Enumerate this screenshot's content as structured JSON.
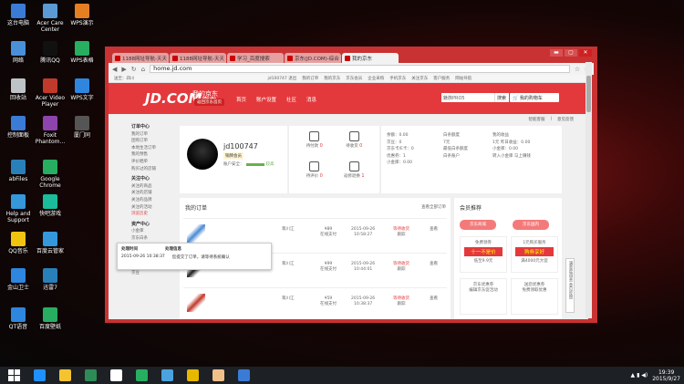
{
  "desktop_icons": [
    {
      "label": "这台电脑",
      "color": "#3a7bd5"
    },
    {
      "label": "Acer Care Center",
      "color": "#5b9bd5"
    },
    {
      "label": "WPS演示",
      "color": "#e67e22"
    },
    {
      "label": "网络",
      "color": "#4a90d9"
    },
    {
      "label": "腾讯QQ",
      "color": "#111111"
    },
    {
      "label": "WPS表格",
      "color": "#27ae60"
    },
    {
      "label": "回收站",
      "color": "#bdc3c7"
    },
    {
      "label": "Acer Video Player",
      "color": "#c0392b"
    },
    {
      "label": "WPS文字",
      "color": "#2e86de"
    },
    {
      "label": "控制面板",
      "color": "#3a7bd5"
    },
    {
      "label": "Foxit Phantom...",
      "color": "#8e44ad"
    },
    {
      "label": "厦门同",
      "color": "#555555"
    },
    {
      "label": "abFiles",
      "color": "#2980b9"
    },
    {
      "label": "Google Chrome",
      "color": "#27ae60"
    },
    {
      "label": "Help and Support",
      "color": "#3498db"
    },
    {
      "label": "快吧游戏",
      "color": "#1abc9c"
    },
    {
      "label": "QQ音乐",
      "color": "#f1c40f"
    },
    {
      "label": "百度云管家",
      "color": "#3498db"
    },
    {
      "label": "金山卫士",
      "color": "#2e86de"
    },
    {
      "label": "迅雷7",
      "color": "#2980b9"
    },
    {
      "label": "QT语音",
      "color": "#2e86de"
    },
    {
      "label": "百度壁纸",
      "color": "#27ae60"
    }
  ],
  "browser": {
    "tabs": [
      "1188网址导航-天天",
      "1188网址导航-天天",
      "学习_百度搜索",
      "京东(JD.COM)-综合",
      "我的京东"
    ],
    "url": "home.jd.com",
    "window_controls": [
      "▬",
      "▢",
      "✕"
    ]
  },
  "jd": {
    "topbar": [
      "送至：四川",
      "jd100747 退出",
      "我的订单",
      "我的京东",
      "京东会员",
      "企业采购",
      "手机京东",
      "关注京东",
      "客户服务",
      "网站导航"
    ],
    "logo": "JD.COM",
    "logo_cn": "京东",
    "my_title": "我的京东",
    "back_home": "返回京东首页",
    "nav": [
      "首页",
      "账户设置",
      "社区",
      "消息"
    ],
    "search_placeholder": "魅族PRO5",
    "search_btn": "搜索",
    "cart": "我的购物车",
    "breadcrumbs": [
      "智能客服",
      "|",
      "意见反馈"
    ],
    "sidebar": [
      {
        "head": "订单中心",
        "items": [
          "我的订单",
          "团购订单",
          "本地生活订单",
          "我的预售",
          "评价晒单",
          "购买过的店铺"
        ]
      },
      {
        "head": "关注中心",
        "items": [
          "关注的商品",
          "关注的店铺",
          "关注的品牌",
          "关注的活动",
          "浏览历史"
        ]
      },
      {
        "head": "资产中心",
        "items": [
          "小金库",
          "京东白条",
          "余额",
          "优惠券(1)",
          "京东E卡",
          "京东卡",
          "京豆"
        ]
      }
    ],
    "user": {
      "name": "jd100747",
      "level": "铜牌会员",
      "safety_label": "账户安全：",
      "safety_value": "较高"
    },
    "stats": [
      {
        "label": "待付款",
        "count": "0"
      },
      {
        "label": "待收货",
        "count": "0"
      },
      {
        "label": "待评价",
        "count": "0"
      },
      {
        "label": "返修退换",
        "count": "1"
      }
    ],
    "assets": {
      "col1": [
        "余额：0.00",
        "京豆：0",
        "京东卡/E卡：0",
        "优惠券：1",
        "小金库：0.00"
      ],
      "col2": [
        "白条额度",
        "7元",
        "最低白条额度",
        "白条账户"
      ],
      "col3": [
        "我的收益",
        "1元 昨日收益：0.00",
        "小金库：0.00",
        "转入小金库 马上赚钱"
      ]
    },
    "orders_title": "我的订单",
    "orders_all": "查看全部订单",
    "orders": [
      {
        "person": "蒋川江",
        "amount": "¥89",
        "pay": "在线支付",
        "date": "2015-09-26",
        "time": "10:58:27",
        "status": "等待收货",
        "track": "跟踪",
        "action": "查看",
        "color": "#4a8ad4"
      },
      {
        "person": "蒋川江",
        "amount": "¥99",
        "pay": "在线支付",
        "date": "2015-09-26",
        "time": "10:44:01",
        "status": "等待收货",
        "track": "跟踪",
        "action": "查看",
        "color": "#222222"
      },
      {
        "person": "蒋川江",
        "amount": "¥59",
        "pay": "在线支付",
        "date": "2015-09-26",
        "time": "10:38:37",
        "status": "等待收货",
        "track": "跟踪",
        "action": "查看",
        "color": "#c0392b"
      }
    ],
    "tip": {
      "col1_head": "处理时间",
      "col2_head": "处理信息",
      "time": "2015-09-26 10:38:37",
      "info": "您提交了订单，请等待系统确认"
    },
    "rec_title": "会员推荐",
    "rec_buttons": [
      "京东商城",
      "京东国内"
    ],
    "rec_boxes": [
      {
        "top": "免费领券",
        "mid": "十一不是价",
        "bot": "低至9.9元"
      },
      {
        "top": "1元购买服务",
        "mid": "购券享好",
        "bot": "满4000元大促"
      },
      {
        "top": "京东优惠券",
        "mid": "",
        "bot": "编辑京东促活动"
      },
      {
        "top": "送您优惠券",
        "mid": "",
        "bot": "免费领取优惠"
      }
    ],
    "feedback": "满意度调查 意见反馈"
  },
  "taskbar": {
    "time": "19:39",
    "date": "2015/9/27",
    "apps": [
      "#1e90ff",
      "#f4c430",
      "#2e8b57",
      "#ffffff",
      "#27ae60",
      "#4aa3df",
      "#e6b800",
      "#f0c08a",
      "#3a7bd5"
    ]
  }
}
